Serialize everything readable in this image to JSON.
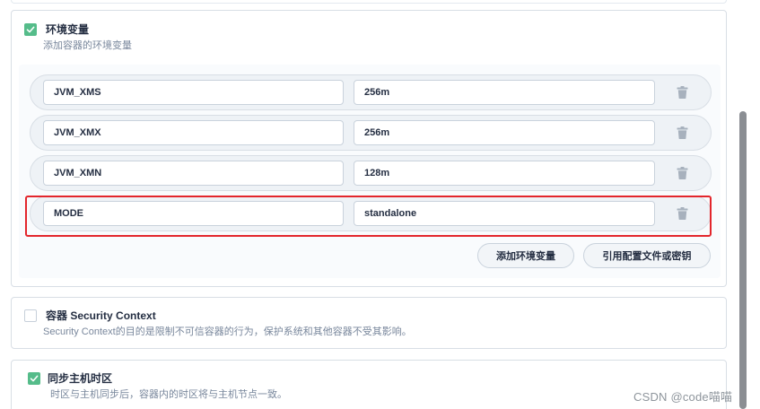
{
  "env_section": {
    "checked": true,
    "title": "环境变量",
    "description": "添加容器的环境变量",
    "rows": [
      {
        "key": "JVM_XMS",
        "value": "256m"
      },
      {
        "key": "JVM_XMX",
        "value": "256m"
      },
      {
        "key": "JVM_XMN",
        "value": "128m"
      },
      {
        "key": "MODE",
        "value": "standalone"
      }
    ],
    "highlighted_row": "MODE",
    "add_button": "添加环境变量",
    "ref_button": "引用配置文件或密钥"
  },
  "security_section": {
    "checked": false,
    "title": "容器 Security Context",
    "description": "Security Context的目的是限制不可信容器的行为，保护系统和其他容器不受其影响。"
  },
  "timezone_section": {
    "checked": true,
    "title": "同步主机时区",
    "description": "时区与主机同步后，容器内的时区将与主机节点一致。"
  },
  "watermark": "CSDN @code喵喵",
  "colors": {
    "accent_green": "#55bc8a",
    "highlight_red": "#e3262c",
    "text_dark": "#242e42",
    "text_muted": "#79879c"
  },
  "icons": {
    "checkbox_checked": "check-icon",
    "delete": "trash-icon"
  }
}
